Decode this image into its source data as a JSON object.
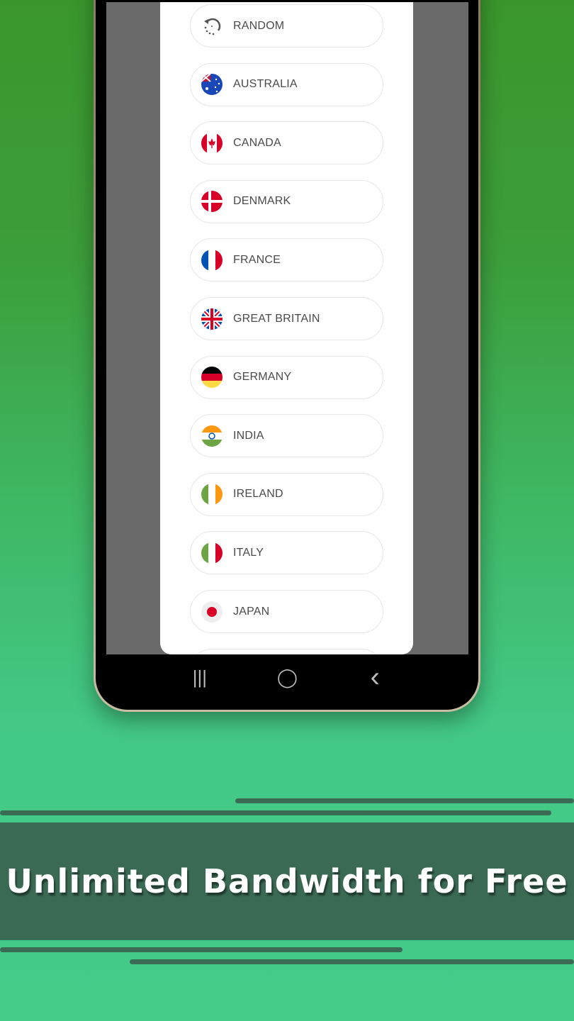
{
  "servers": [
    {
      "label": "RANDOM",
      "icon": "random-icon"
    },
    {
      "label": "AUSTRALIA",
      "icon": "flag-australia-icon"
    },
    {
      "label": "CANADA",
      "icon": "flag-canada-icon"
    },
    {
      "label": "DENMARK",
      "icon": "flag-denmark-icon"
    },
    {
      "label": "FRANCE",
      "icon": "flag-france-icon"
    },
    {
      "label": "GREAT BRITAIN",
      "icon": "flag-great-britain-icon"
    },
    {
      "label": "GERMANY",
      "icon": "flag-germany-icon"
    },
    {
      "label": "INDIA",
      "icon": "flag-india-icon"
    },
    {
      "label": "IRELAND",
      "icon": "flag-ireland-icon"
    },
    {
      "label": "ITALY",
      "icon": "flag-italy-icon"
    },
    {
      "label": "JAPAN",
      "icon": "flag-japan-icon"
    }
  ],
  "navbar": {
    "recents": "|||",
    "home": "◯",
    "back": "‹"
  },
  "banner": {
    "title": "Unlimited Bandwidth for Free"
  },
  "colors": {
    "banner": "#3a6a54",
    "background_top": "#3a962c",
    "background_bottom": "#44cb88"
  }
}
